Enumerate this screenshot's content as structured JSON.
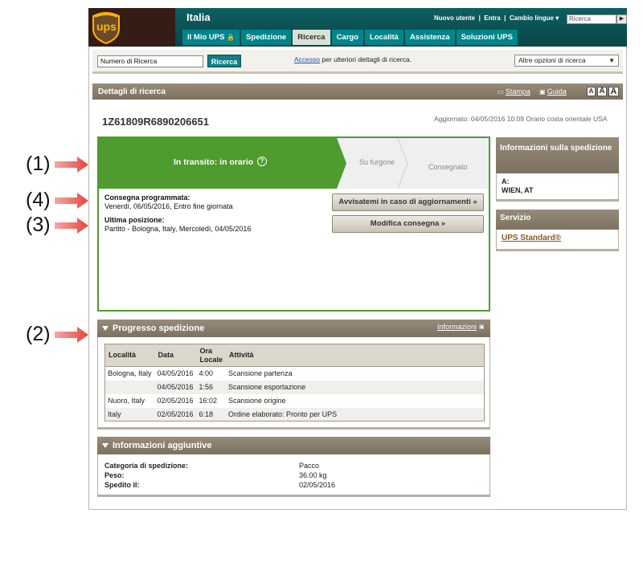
{
  "annotations": [
    "(1)",
    "(4)",
    "(3)",
    "(2)"
  ],
  "header": {
    "logo_text": "ups",
    "country": "Italia",
    "new_user": "Nuovo utente",
    "login": "Entra",
    "language": "Cambio lingue",
    "search_placeholder": "Ricerca",
    "nav": [
      "Il Mio UPS",
      "Spedizione",
      "Ricerca",
      "Cargo",
      "Località",
      "Assistenza",
      "Soluzioni UPS"
    ]
  },
  "search": {
    "tracking_placeholder": "Numero di Ricerca",
    "button": "Ricerca",
    "access_link": "Accesso",
    "access_rest": " per ulteriori dettagli di ricerca.",
    "more_options": "Altre opzioni di ricerca"
  },
  "details": {
    "title": "Dettagli di ricerca",
    "print": "Stampa",
    "guide": "Guida",
    "font_sizes": [
      "A",
      "A",
      "A"
    ],
    "tracking_number": "1Z61809R6890206651",
    "updated": "Aggiornato: 04/05/2016 10:09 Orario costa orientale USA"
  },
  "status": {
    "current": "In transito: in orario",
    "step2": "Su furgone",
    "step3": "Consegnato",
    "scheduled_label": "Consegna programmata:",
    "scheduled_value": "Venerdì, 06/05/2016, Entro fine giornata",
    "last_label": "Ultima posizione:",
    "last_value": "Partito - Bologna, Italy, Mercoledì, 04/05/2016",
    "notify_button": "Avvisatemi in caso di aggiornamenti »",
    "modify_button": "Modifica consegna »"
  },
  "shipment_info": {
    "title": "Informazioni sulla spedizione",
    "to_label": "A:",
    "to_value": "WIEN, AT"
  },
  "service": {
    "title": "Servizio",
    "value": "UPS Standard®"
  },
  "progress": {
    "title": "Progresso spedizione",
    "info_link": "Informazioni",
    "headers": [
      "Località",
      "Data",
      "Ora Locale",
      "Attività"
    ],
    "rows": [
      [
        "Bologna, Italy",
        "04/05/2016",
        "4:00",
        "Scansione partenza"
      ],
      [
        "",
        "04/05/2016",
        "1:56",
        "Scansione esportazione"
      ],
      [
        "Nuoro, Italy",
        "02/05/2016",
        "16:02",
        "Scansione origine"
      ],
      [
        "Italy",
        "02/05/2016",
        "6:18",
        "Ordine elaborato: Pronto per UPS"
      ]
    ]
  },
  "additional": {
    "title": "Informazioni aggiuntive",
    "category_label": "Categoria di spedizione:",
    "category_value": "Pacco",
    "weight_label": "Peso:",
    "weight_value": "36.00 kg",
    "shipped_label": "Spedito il:",
    "shipped_value": "02/05/2016"
  },
  "colors": {
    "brand_brown": "#351c15",
    "header_teal": "#0a4548",
    "status_green": "#4e9b2e",
    "bar_taupe": "#8a7e6c",
    "arrow_red": "#e8433f"
  }
}
